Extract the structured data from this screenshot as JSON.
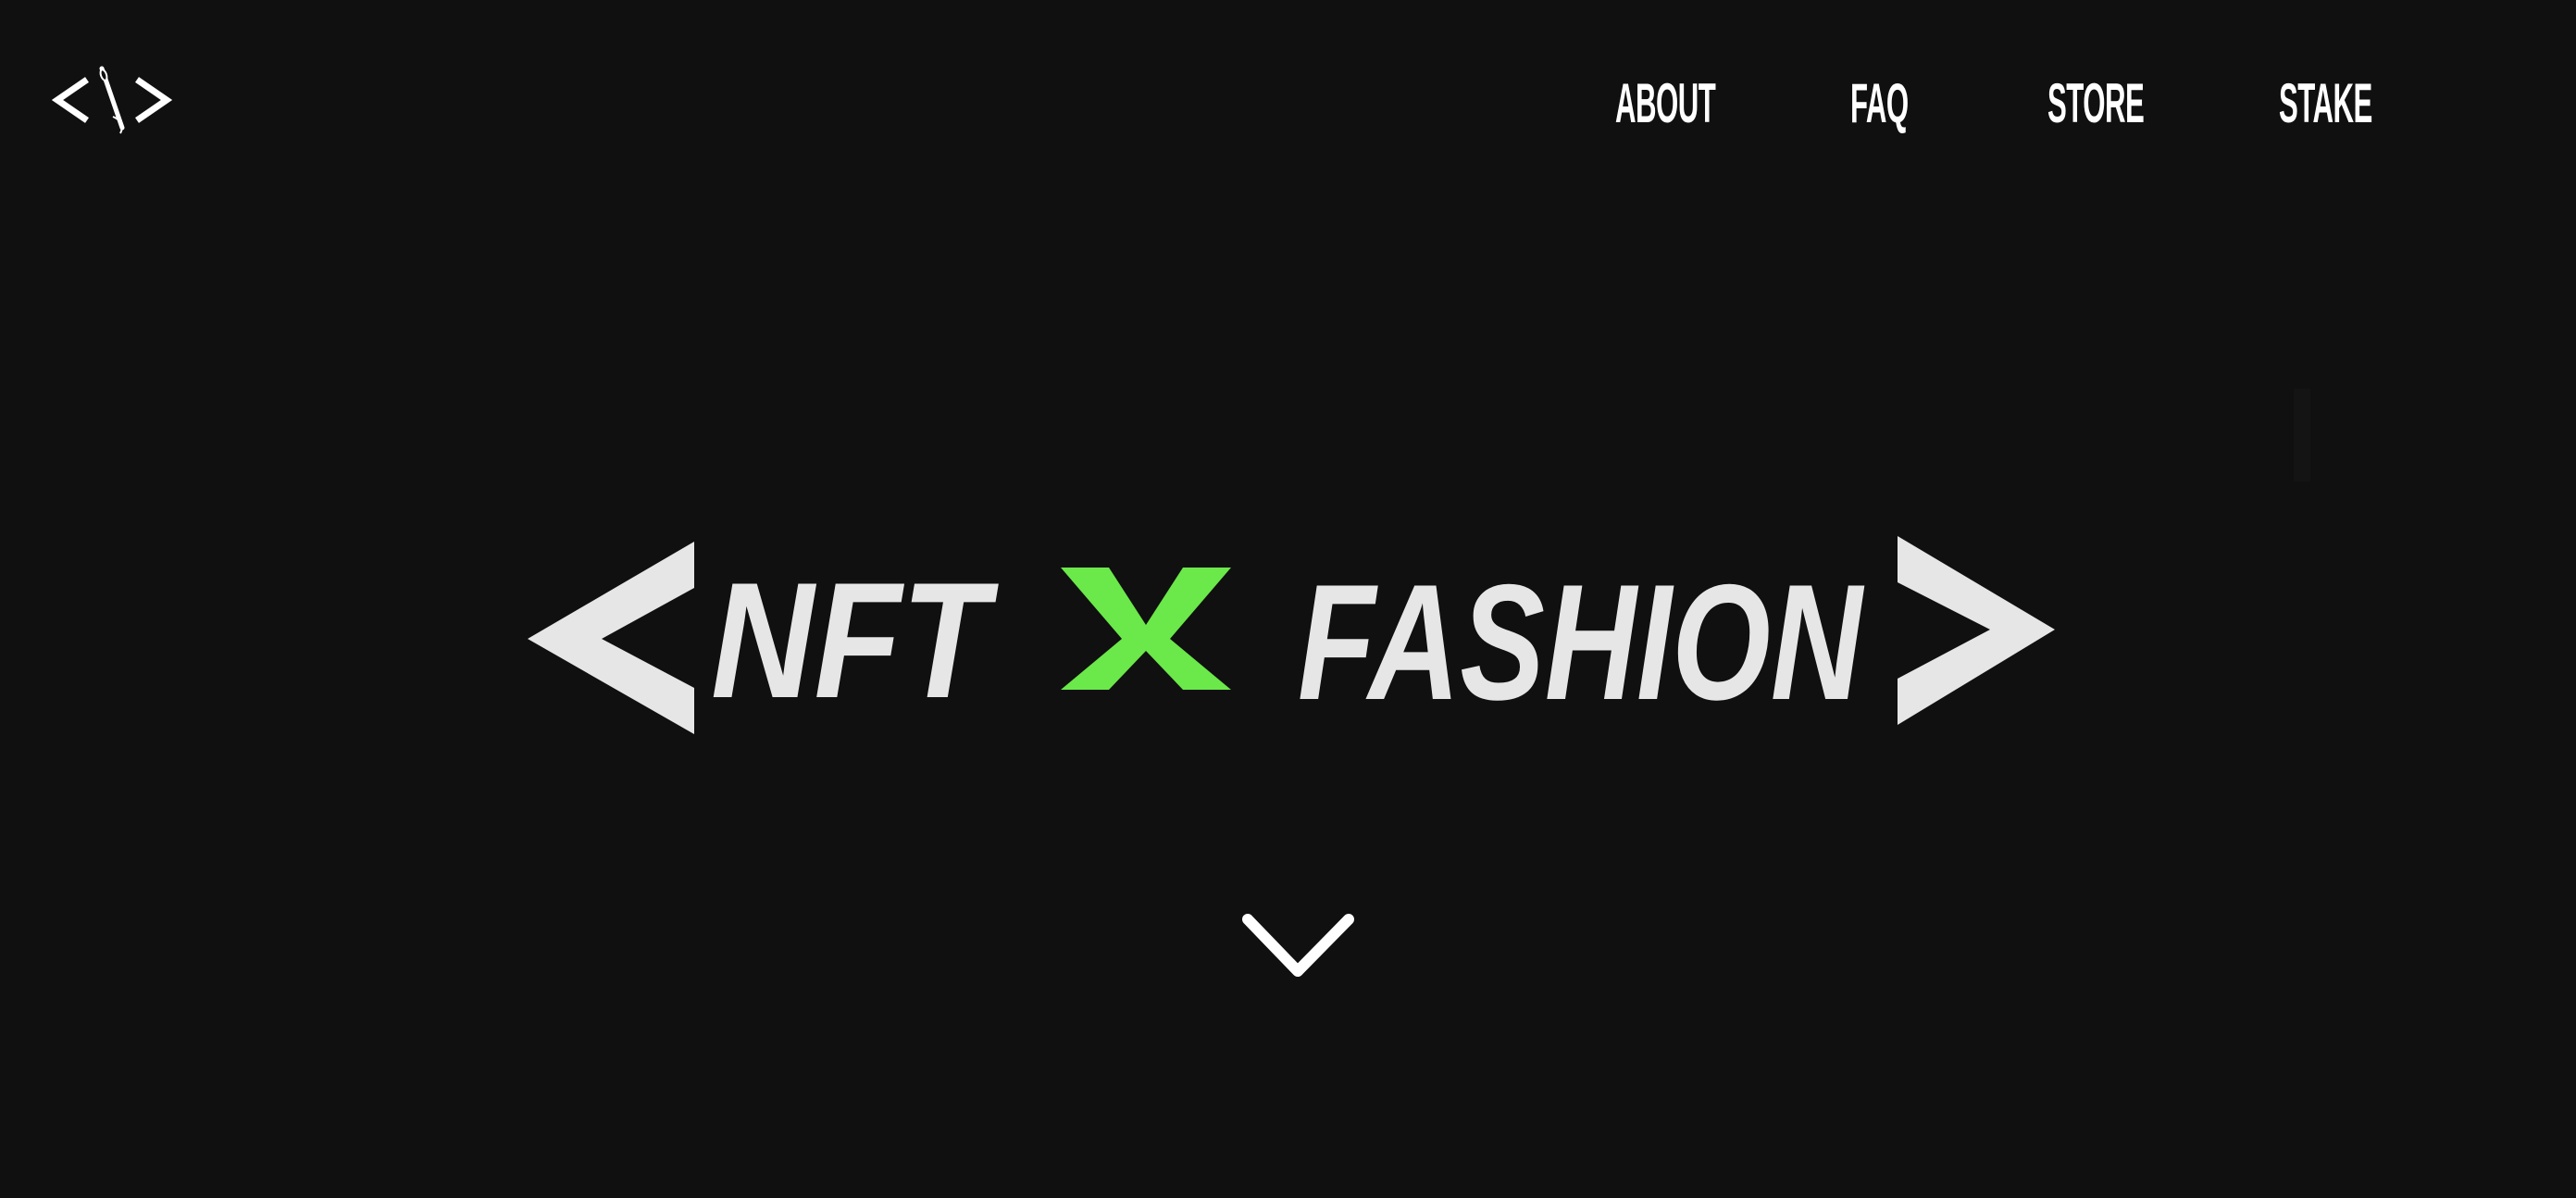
{
  "colors": {
    "background": "#101010",
    "text": "#ffffff",
    "hero_gray": "#e6e6e6",
    "accent_green": "#6be84a"
  },
  "header": {
    "logo_icon": "code-needle-logo-icon",
    "logo_text": "</>",
    "nav": [
      {
        "label": "ABOUT"
      },
      {
        "label": "FAQ"
      },
      {
        "label": "STORE"
      },
      {
        "label": "STAKE"
      }
    ]
  },
  "hero": {
    "open_bracket": "<",
    "word_left": "NFT",
    "connector": "X",
    "word_right": "FASHION",
    "close_bracket": ">"
  },
  "scroll": {
    "icon": "chevron-down-icon"
  }
}
